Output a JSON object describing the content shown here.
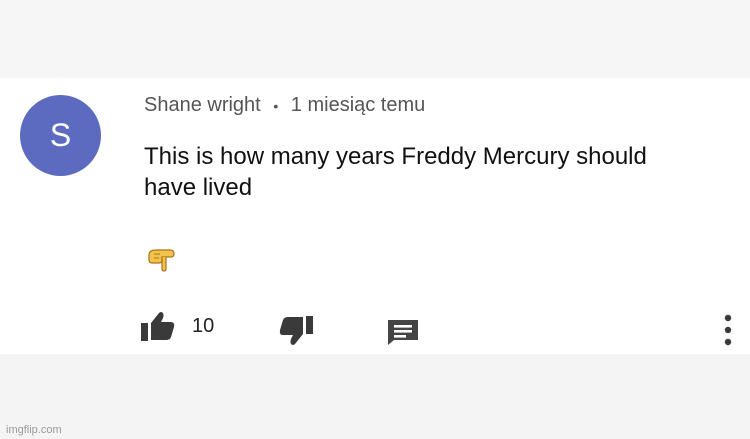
{
  "comment": {
    "avatar_letter": "S",
    "author": "Shane wright",
    "separator": "•",
    "time": "1 miesiąc temu",
    "text": "This  is  how many years Freddy Mercury should have lived",
    "emoji": "pointing-down-hand",
    "likes": "10",
    "accent_color": "#5c6bc0"
  },
  "actions": {
    "like_icon": "thumbs-up-icon",
    "dislike_icon": "thumbs-down-icon",
    "reply_icon": "reply-comment-icon",
    "more_icon": "more-vertical-icon"
  },
  "watermark": "imgflip.com"
}
